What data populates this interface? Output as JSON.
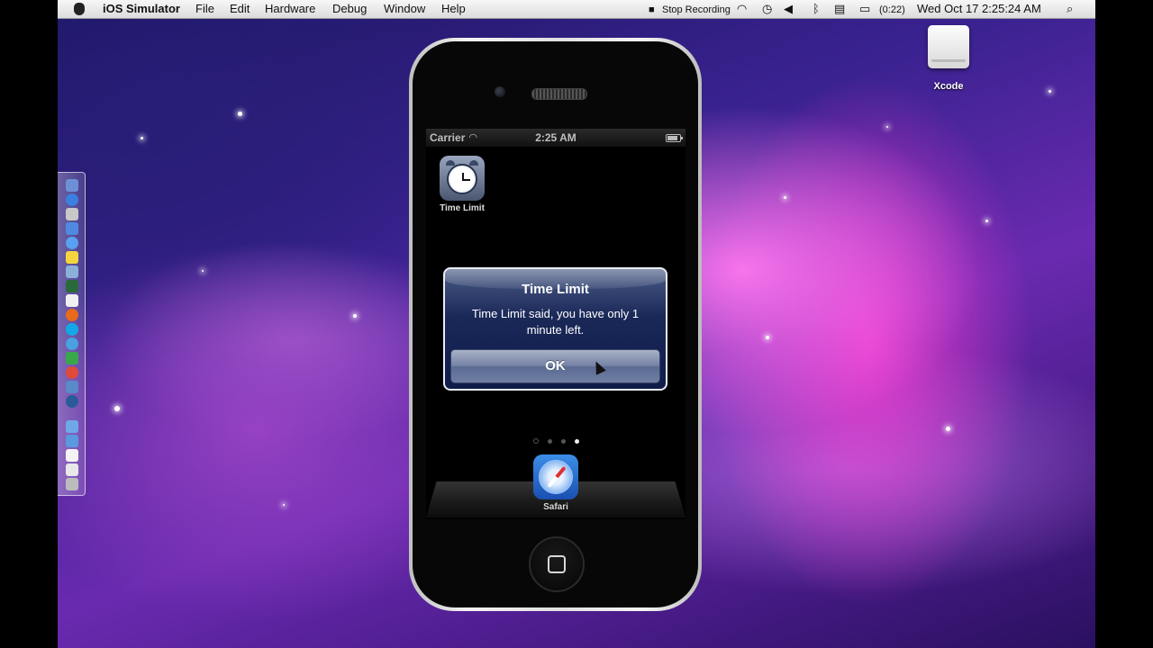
{
  "menubar": {
    "app_name": "iOS Simulator",
    "menus": [
      "File",
      "Edit",
      "Hardware",
      "Debug",
      "Window",
      "Help"
    ],
    "stop_recording": "Stop Recording",
    "battery_time": "(0:22)",
    "datetime": "Wed Oct 17  2:25:24 AM"
  },
  "desktop": {
    "drive_label": "Xcode"
  },
  "ios": {
    "carrier": "Carrier",
    "time": "2:25 AM",
    "apps": [
      {
        "label": "Time Limit",
        "icon": "alarm-clock-icon"
      },
      {
        "label": "Safari",
        "icon": "compass-icon"
      }
    ],
    "page_count": 3,
    "active_page": 3
  },
  "alert": {
    "title": "Time Limit",
    "message": "Time Limit said, you have only 1 minute left.",
    "button": "OK"
  }
}
